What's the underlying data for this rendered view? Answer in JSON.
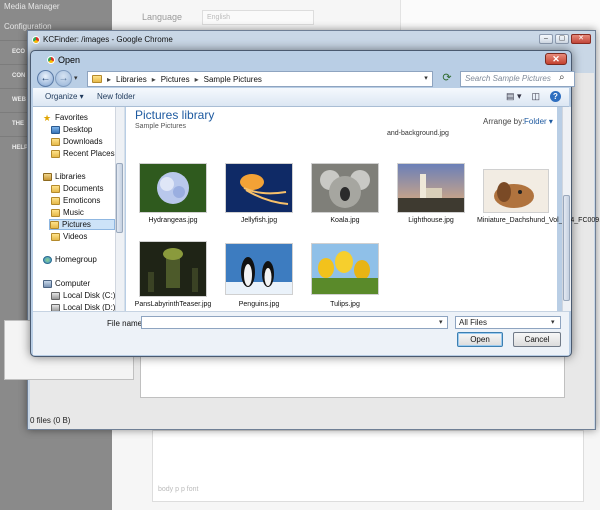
{
  "background": {
    "sidebar_title": "Media Manager",
    "sidebar_section": "Configuration",
    "sidebar_items": [
      "ECO",
      "CON",
      "WEB",
      "THE",
      "HELP"
    ],
    "language_label": "Language",
    "language_value": "English",
    "editor_status": "body  p  p  font"
  },
  "chrome": {
    "title": "KCFinder: /images - Google Chrome",
    "status": "0 files (0 B)"
  },
  "dialog": {
    "title": "Open",
    "breadcrumb": [
      "Libraries",
      "Pictures",
      "Sample Pictures"
    ],
    "search_placeholder": "Search Sample Pictures",
    "toolbar": {
      "organize": "Organize ▾",
      "new_folder": "New folder"
    },
    "nav": {
      "favorites": "Favorites",
      "favorites_items": [
        "Desktop",
        "Downloads",
        "Recent Places"
      ],
      "libraries": "Libraries",
      "libraries_items": [
        "Documents",
        "Emoticons",
        "Music",
        "Pictures",
        "Videos"
      ],
      "homegroup": "Homegroup",
      "computer": "Computer",
      "computer_items": [
        "Local Disk (C:)",
        "Local Disk (D:)"
      ]
    },
    "library_title": "Pictures library",
    "library_subtitle": "Sample Pictures",
    "arrange_label": "Arrange by:",
    "arrange_value": "Folder ▾",
    "cut_off_file": "and-background.jpg",
    "files": [
      {
        "name": "Hydrangeas.jpg",
        "color": "#4e7a2e"
      },
      {
        "name": "Jellyfish.jpg",
        "color": "#1d3f7a"
      },
      {
        "name": "Koala.jpg",
        "color": "#8f8f8a"
      },
      {
        "name": "Lighthouse.jpg",
        "color": "#6c5a86"
      },
      {
        "name": "Miniature_Dachshund_Vol_124_FC009.jpg",
        "color": "#c98f56"
      },
      {
        "name": "PansLabyrinthTeaser.jpg",
        "color": "#2c3220"
      },
      {
        "name": "Penguins.jpg",
        "color": "#3f7fc0"
      },
      {
        "name": "Tulips.jpg",
        "color": "#e1b41f"
      }
    ],
    "file_name_label": "File name:",
    "file_name_value": "",
    "filter_value": "All Files",
    "open_button": "Open",
    "cancel_button": "Cancel"
  }
}
